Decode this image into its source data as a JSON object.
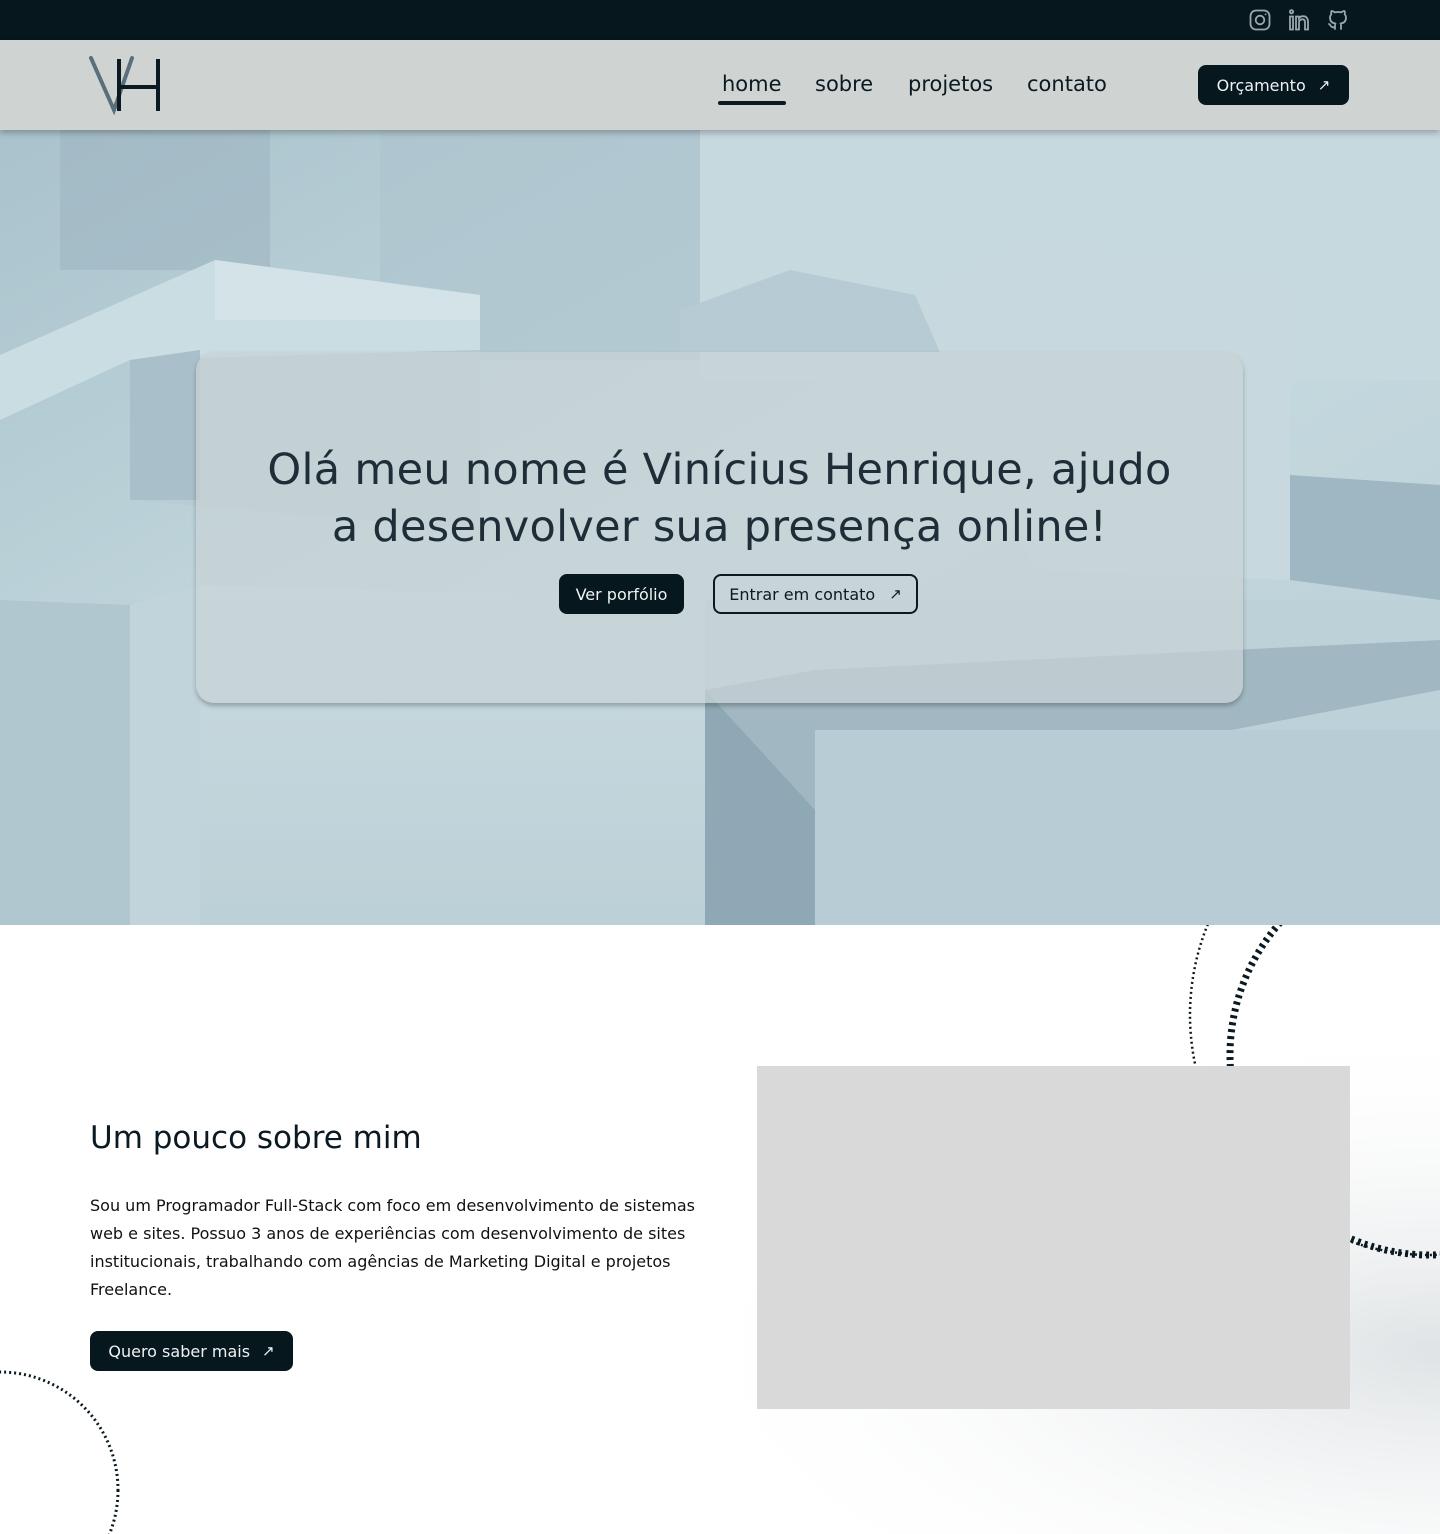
{
  "social": {
    "instagram": "instagram-icon",
    "linkedin": "linkedin-icon",
    "github": "github-icon"
  },
  "header": {
    "logo_text": "VH",
    "nav": [
      "home",
      "sobre",
      "projetos",
      "contato"
    ],
    "active": "home",
    "cta_label": "Orçamento",
    "cta_icon": "arrow-up-right-icon"
  },
  "hero": {
    "line1": "Olá meu nome é Vinícius Henrique, ajudo",
    "line2": "a desenvolver sua presença online!",
    "primary_label": "Ver porfólio",
    "secondary_label": "Entrar em contato",
    "secondary_icon": "arrow-up-right-icon"
  },
  "about": {
    "title": "Um pouco sobre mim",
    "text": "Sou um Programador Full-Stack com foco em desenvolvimento de sistemas web e sites. Possuo 3 anos de experiências com desenvolvimento de sites institucionais, trabalhando com agências de Marketing Digital e projetos Freelance.",
    "button_label": "Quero saber mais",
    "button_icon": "arrow-up-right-icon"
  },
  "colors": {
    "topbar": "#07171e",
    "header": "#cfd4d3",
    "accent_dark": "#07171e",
    "hero_bg": "#bcd3da",
    "image_placeholder": "#d9d9d9"
  }
}
